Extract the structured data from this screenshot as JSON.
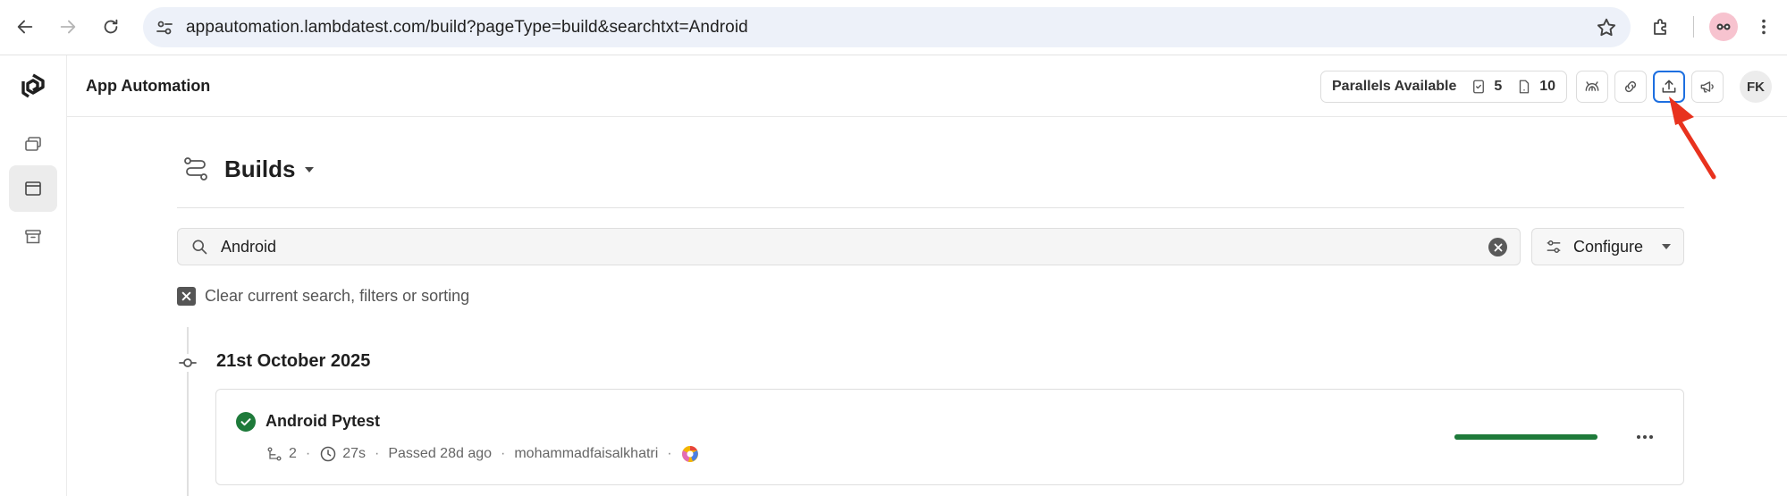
{
  "browser": {
    "url": "appautomation.lambdatest.com/build?pageType=build&searchtxt=Android"
  },
  "header": {
    "title": "App Automation",
    "parallels_label": "Parallels Available",
    "parallels_count_a": "5",
    "parallels_count_b": "10",
    "avatar_initials": "FK"
  },
  "page": {
    "title": "Builds",
    "search_value": "Android",
    "configure_label": "Configure",
    "clear_label": "Clear current search, filters or sorting"
  },
  "timeline": {
    "date": "21st October 2025",
    "builds": [
      {
        "name": "Android Pytest",
        "tests": "2",
        "duration": "27s",
        "status": "Passed 28d ago",
        "user": "mohammadfaisalkhatri",
        "progress": 1.0
      }
    ]
  },
  "colors": {
    "accent_blue": "#1d6fe0",
    "success_green": "#1e7a3a",
    "annotation_red": "#e8321e"
  }
}
